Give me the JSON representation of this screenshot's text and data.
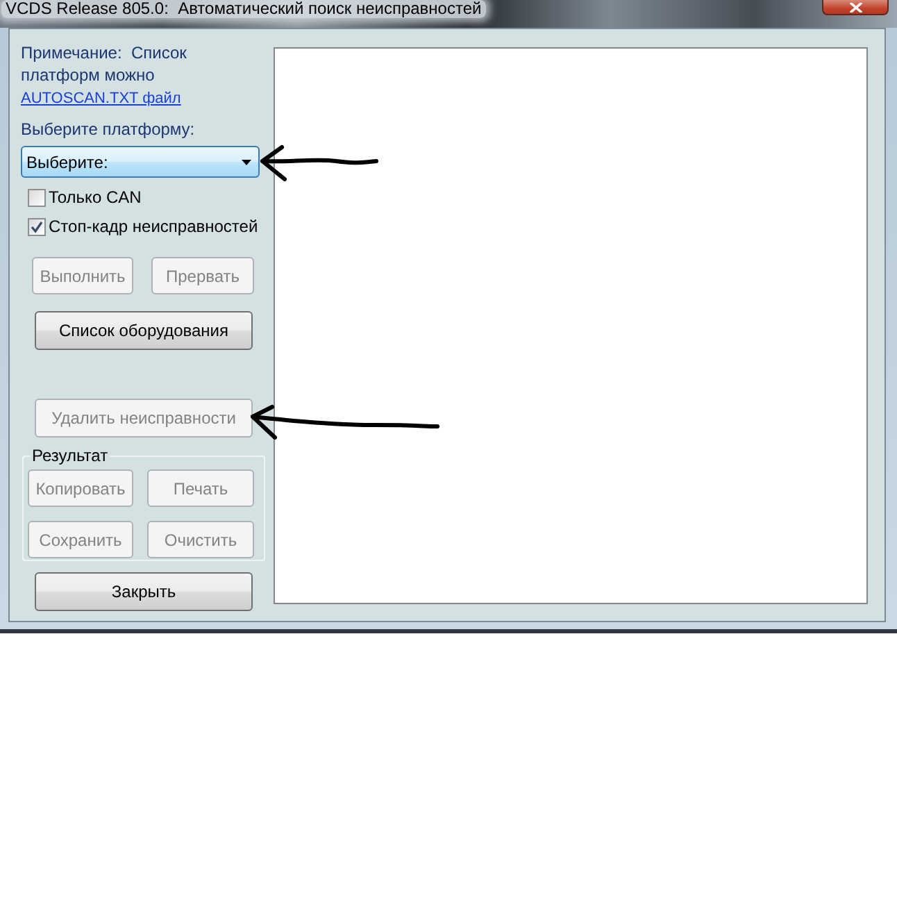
{
  "window": {
    "title": "VCDS Release 805.0:  Автоматический поиск неисправностей"
  },
  "note": {
    "text": "Примечание:  Список платформ можно",
    "link": "AUTOSCAN.TXT файл"
  },
  "platform_select": {
    "label": "Выберите платформу:",
    "value": "Выберите:",
    "marked": true
  },
  "options": [
    {
      "label": "Только CAN",
      "checked": false
    },
    {
      "label": "Стоп-кадр неисправностей",
      "checked": true
    }
  ],
  "run_buttons": [
    {
      "label": "Выполнить",
      "disabled": true
    },
    {
      "label": "Прервать",
      "disabled": true
    }
  ],
  "equipment_button": {
    "label": "Список оборудования",
    "disabled": false
  },
  "clear_faults_button": {
    "label": "Удалить неисправности",
    "disabled": true,
    "marked": true
  },
  "result_group": {
    "title": "Результат",
    "buttons": [
      {
        "label": "Копировать",
        "disabled": true
      },
      {
        "label": "Печать",
        "disabled": true
      },
      {
        "label": "Сохранить",
        "disabled": true
      },
      {
        "label": "Очистить",
        "disabled": true
      }
    ]
  },
  "close_button": {
    "label": "Закрыть",
    "disabled": false
  }
}
